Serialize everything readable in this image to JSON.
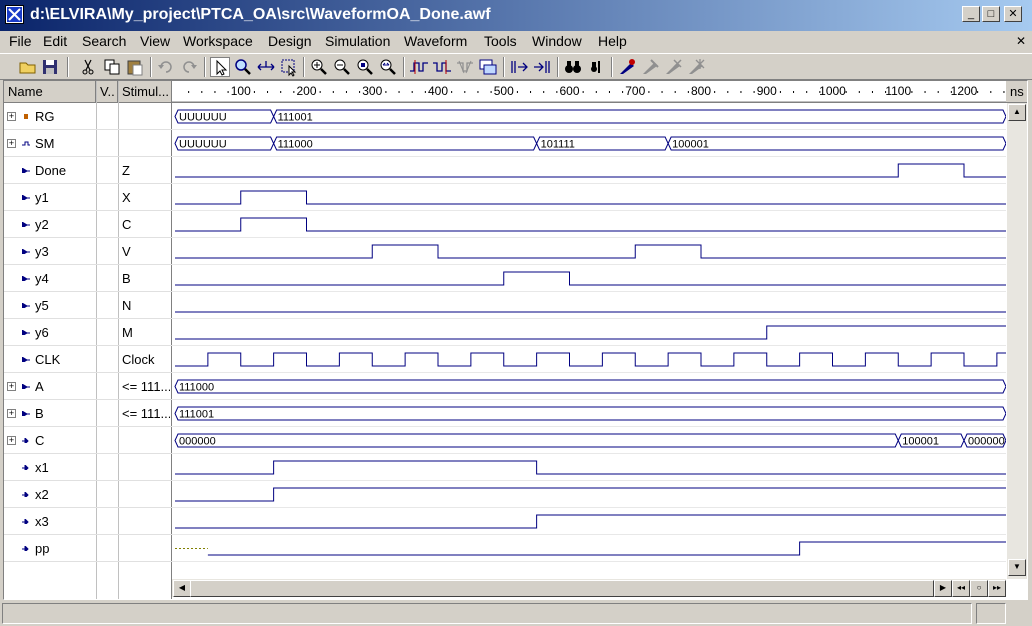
{
  "window": {
    "title": "d:\\ELVIRA\\My_project\\PTCA_OA\\src\\WaveformOA_Done.awf",
    "minimize": "_",
    "maximize": "□",
    "close": "✕"
  },
  "menu": [
    "File",
    "Edit",
    "Search",
    "View",
    "Workspace",
    "Design",
    "Simulation",
    "Waveform",
    "Tools",
    "Window",
    "Help"
  ],
  "menu_close": "✕",
  "columns": {
    "name": "Name",
    "value": "V..",
    "stimulus": "Stimul..."
  },
  "ruler": {
    "ticks": [
      "100",
      "200",
      "300",
      "400",
      "500",
      "600",
      "700",
      "800",
      "900",
      "1000",
      "1100",
      "1200"
    ],
    "unit": "ns"
  },
  "signals": [
    {
      "name": "RG",
      "stim": "",
      "kind": "bus",
      "expandable": true,
      "icon": "register-icon",
      "segments": [
        {
          "t0": 0,
          "t1": 150,
          "v": "UUUUUU"
        },
        {
          "t0": 150,
          "t1": 1265,
          "v": "111001"
        }
      ]
    },
    {
      "name": "SM",
      "stim": "",
      "kind": "bus",
      "expandable": true,
      "icon": "bus-signal-icon",
      "segments": [
        {
          "t0": 0,
          "t1": 150,
          "v": "UUUUUU"
        },
        {
          "t0": 150,
          "t1": 550,
          "v": "111000"
        },
        {
          "t0": 550,
          "t1": 750,
          "v": "101111"
        },
        {
          "t0": 750,
          "t1": 1265,
          "v": "100001"
        }
      ]
    },
    {
      "name": "Done",
      "stim": "Z",
      "kind": "bit",
      "expandable": false,
      "icon": "output-port-icon",
      "edges": [
        [
          0,
          0
        ],
        [
          1100,
          1
        ],
        [
          1200,
          0
        ]
      ]
    },
    {
      "name": "y1",
      "stim": "X",
      "kind": "bit",
      "expandable": false,
      "icon": "output-port-icon",
      "edges": [
        [
          0,
          0
        ],
        [
          100,
          1
        ],
        [
          200,
          0
        ]
      ]
    },
    {
      "name": "y2",
      "stim": "C",
      "kind": "bit",
      "expandable": false,
      "icon": "output-port-icon",
      "edges": [
        [
          0,
          0
        ],
        [
          100,
          1
        ],
        [
          200,
          0
        ]
      ]
    },
    {
      "name": "y3",
      "stim": "V",
      "kind": "bit",
      "expandable": false,
      "icon": "output-port-icon",
      "edges": [
        [
          0,
          0
        ],
        [
          300,
          1
        ],
        [
          400,
          0
        ],
        [
          700,
          1
        ],
        [
          800,
          0
        ]
      ]
    },
    {
      "name": "y4",
      "stim": "B",
      "kind": "bit",
      "expandable": false,
      "icon": "output-port-icon",
      "edges": [
        [
          0,
          0
        ],
        [
          500,
          1
        ],
        [
          600,
          0
        ]
      ]
    },
    {
      "name": "y5",
      "stim": "N",
      "kind": "bit",
      "expandable": false,
      "icon": "output-port-icon",
      "edges": [
        [
          0,
          0
        ]
      ]
    },
    {
      "name": "y6",
      "stim": "M",
      "kind": "bit",
      "expandable": false,
      "icon": "output-port-icon",
      "edges": [
        [
          0,
          0
        ],
        [
          900,
          1
        ]
      ]
    },
    {
      "name": "CLK",
      "stim": "Clock",
      "kind": "clock",
      "expandable": false,
      "icon": "output-port-icon",
      "period": 100
    },
    {
      "name": "A",
      "stim": "<= 111...",
      "kind": "bus",
      "expandable": true,
      "icon": "output-port-icon",
      "segments": [
        {
          "t0": 0,
          "t1": 1265,
          "v": "111000"
        }
      ]
    },
    {
      "name": "B",
      "stim": "<= 111...",
      "kind": "bus",
      "expandable": true,
      "icon": "output-port-icon",
      "segments": [
        {
          "t0": 0,
          "t1": 1265,
          "v": "111001"
        }
      ]
    },
    {
      "name": "C",
      "stim": "",
      "kind": "bus",
      "expandable": true,
      "icon": "input-port-icon",
      "segments": [
        {
          "t0": 0,
          "t1": 1100,
          "v": "000000"
        },
        {
          "t0": 1100,
          "t1": 1200,
          "v": "100001"
        },
        {
          "t0": 1200,
          "t1": 1265,
          "v": "000000"
        }
      ]
    },
    {
      "name": "x1",
      "stim": "",
      "kind": "bit",
      "expandable": false,
      "icon": "input-port-icon",
      "edges": [
        [
          0,
          0
        ],
        [
          150,
          1
        ],
        [
          550,
          0
        ]
      ]
    },
    {
      "name": "x2",
      "stim": "",
      "kind": "bit",
      "expandable": false,
      "icon": "input-port-icon",
      "edges": [
        [
          0,
          0
        ],
        [
          150,
          1
        ]
      ]
    },
    {
      "name": "x3",
      "stim": "",
      "kind": "bit",
      "expandable": false,
      "icon": "input-port-icon",
      "edges": [
        [
          0,
          0
        ],
        [
          550,
          1
        ]
      ]
    },
    {
      "name": "pp",
      "stim": "",
      "kind": "bit",
      "expandable": false,
      "icon": "input-port-icon",
      "edges": [
        [
          0,
          "U"
        ],
        [
          50,
          0
        ],
        [
          950,
          1
        ]
      ]
    }
  ],
  "colors": {
    "wave": "#000080",
    "highlight": "#0a246a",
    "undefined": "#808000"
  }
}
